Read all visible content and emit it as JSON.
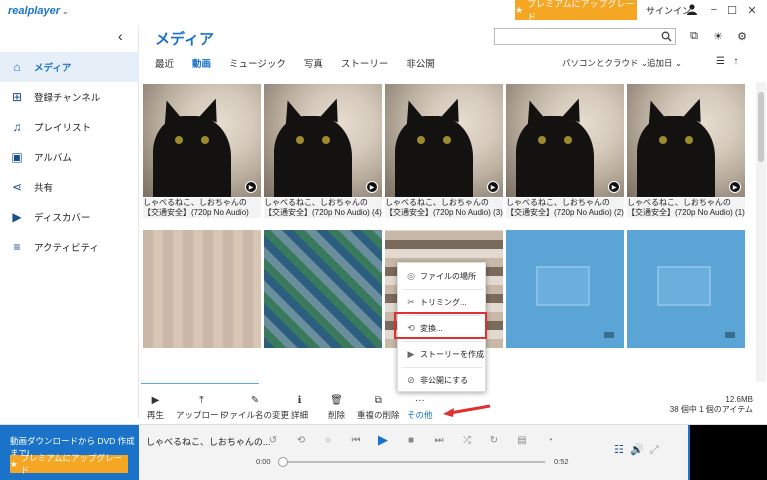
{
  "app": {
    "logo": "realplayer",
    "premium_button": "プレミアムにアップグレード",
    "signin": "サインイン"
  },
  "sidebar": {
    "items": [
      {
        "label": "メディア",
        "icon": "home-icon",
        "active": true
      },
      {
        "label": "登録チャンネル",
        "icon": "plus-square-icon",
        "active": false
      },
      {
        "label": "プレイリスト",
        "icon": "music-note-icon",
        "active": false
      },
      {
        "label": "アルバム",
        "icon": "album-icon",
        "active": false
      },
      {
        "label": "共有",
        "icon": "share-icon",
        "active": false
      },
      {
        "label": "ディスカバー",
        "icon": "play-circle-icon",
        "active": false
      },
      {
        "label": "アクティビティ",
        "icon": "sliders-icon",
        "active": false
      }
    ]
  },
  "main": {
    "title": "メディア",
    "search_placeholder": "",
    "tabs": [
      {
        "label": "最近",
        "active": false
      },
      {
        "label": "動画",
        "active": true
      },
      {
        "label": "ミュージック",
        "active": false
      },
      {
        "label": "写真",
        "active": false
      },
      {
        "label": "ストーリー",
        "active": false
      },
      {
        "label": "非公開",
        "active": false
      }
    ],
    "source_select": "パソコンとクラウド",
    "sort_select": "追加日"
  },
  "videos": [
    {
      "caption": "しゃべるねこ、しおちゃんの【交通安全】(720p No Audio)"
    },
    {
      "caption": "しゃべるねこ、しおちゃんの【交通安全】(720p No Audio) (4)"
    },
    {
      "caption": "しゃべるねこ、しおちゃんの【交通安全】(720p No Audio) (3)"
    },
    {
      "caption": "しゃべるねこ、しおちゃんの【交通安全】(720p No Audio) (2)"
    },
    {
      "caption": "しゃべるねこ、しおちゃんの【交通安全】(720p No Audio) (1)"
    }
  ],
  "context_menu": {
    "items": [
      {
        "label": "ファイルの場所",
        "icon": "folder-target-icon"
      },
      {
        "label": "トリミング...",
        "icon": "scissors-icon"
      },
      {
        "label": "変換...",
        "icon": "convert-icon"
      },
      {
        "label": "ストーリーを作成",
        "icon": "story-icon"
      },
      {
        "label": "非公開にする",
        "icon": "eye-off-icon"
      }
    ]
  },
  "actions": [
    {
      "label": "再生",
      "icon": "play-icon"
    },
    {
      "label": "アップロード",
      "icon": "upload-icon"
    },
    {
      "label": "ファイル名の変更",
      "icon": "pencil-icon"
    },
    {
      "label": "詳細",
      "icon": "info-icon"
    },
    {
      "label": "削除",
      "icon": "trash-icon"
    },
    {
      "label": "重複の削除",
      "icon": "duplicate-icon"
    },
    {
      "label": "その他",
      "icon": "more-icon"
    }
  ],
  "storage": {
    "size": "12.6MB",
    "count": "38 個中 1 個のアイテム"
  },
  "player": {
    "promo_text": "動画ダウンロードから DVD 作成まで!",
    "promo_button": "プレミアムにアップグレード",
    "now_playing": "しゃべるねこ、しおちゃんの...",
    "time_current": "0:00",
    "time_total": "0:52"
  },
  "colors": {
    "accent": "#1a73c9",
    "premium": "#f5a623",
    "highlight": "#e03030"
  }
}
